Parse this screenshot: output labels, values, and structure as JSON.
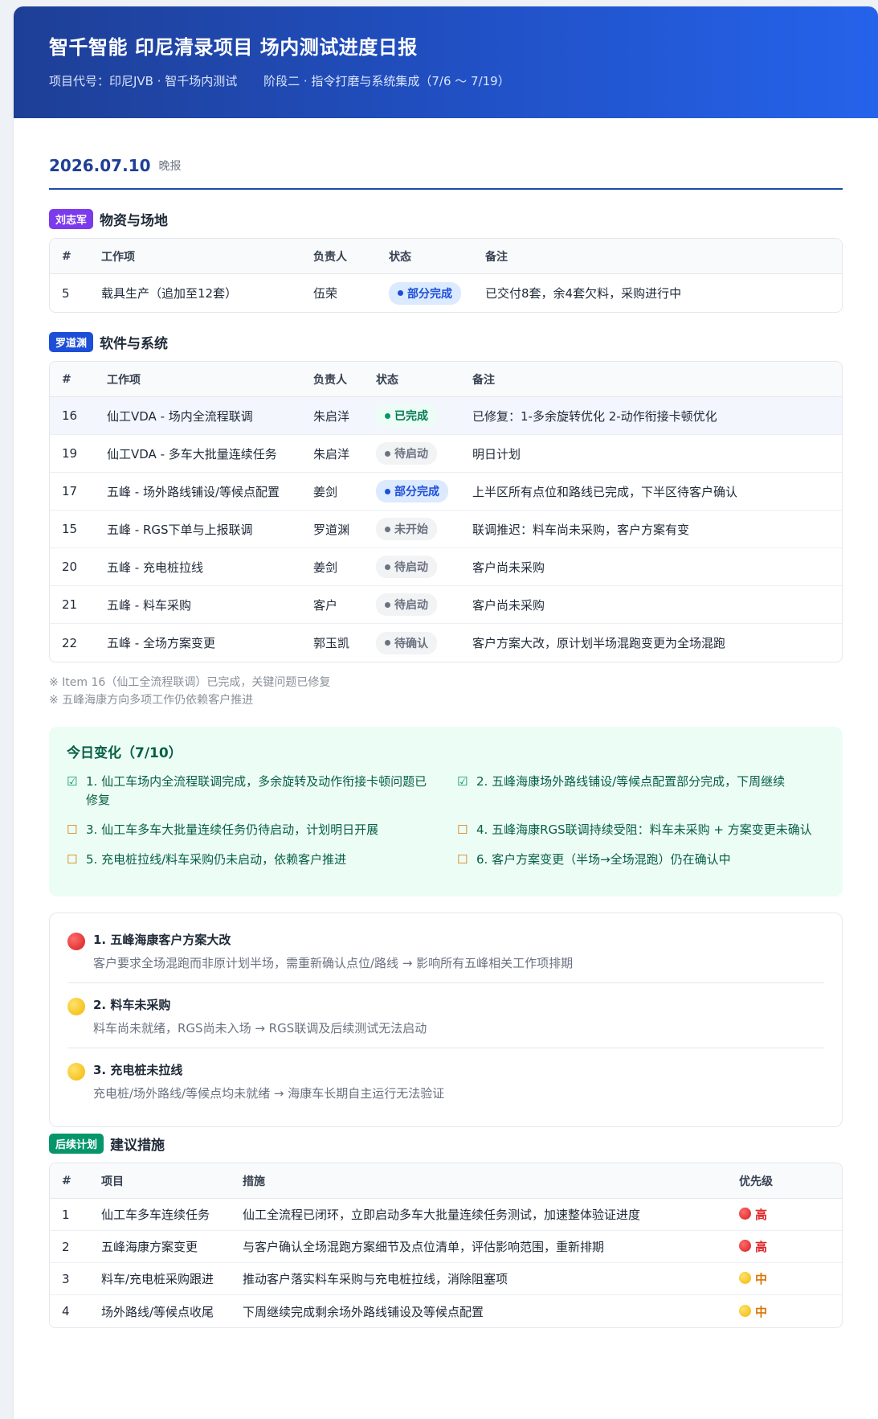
{
  "header": {
    "title": "智千智能 印尼清录项目 场内测试进度日报",
    "project_code": "项目代号：印尼JVB · 智千场内测试",
    "phase": "阶段二 · 指令打磨与系统集成（7/6 ～ 7/19）"
  },
  "report": {
    "date": "2026.07.10",
    "tag": "晚报"
  },
  "section_materials": {
    "owner": "刘志军",
    "owner_color": "#7c3aed",
    "title": "物资与场地",
    "columns": [
      "#",
      "工作项",
      "负责人",
      "状态",
      "备注"
    ],
    "rows": [
      {
        "no": "5",
        "item": "载具生产（追加至12套）",
        "owner": "伍荣",
        "status": "部分完成",
        "note": "已交付8套，余4套欠料，采购进行中"
      }
    ]
  },
  "section_software": {
    "owner": "罗道渊",
    "owner_color": "#1d4ed8",
    "title": "软件与系统",
    "columns": [
      "#",
      "工作项",
      "负责人",
      "状态",
      "备注"
    ],
    "rows": [
      {
        "no": "16",
        "item": "仙工VDA - 场内全流程联调",
        "owner": "朱启洋",
        "status": "已完成",
        "note": "已修复：1-多余旋转优化 2-动作衔接卡顿优化"
      },
      {
        "no": "19",
        "item": "仙工VDA - 多车大批量连续任务",
        "owner": "朱启洋",
        "status": "待启动",
        "note": "明日计划"
      },
      {
        "no": "17",
        "item": "五峰 - 场外路线铺设/等候点配置",
        "owner": "姜剑",
        "status": "部分完成",
        "note": "上半区所有点位和路线已完成，下半区待客户确认"
      },
      {
        "no": "15",
        "item": "五峰 - RGS下单与上报联调",
        "owner": "罗道渊",
        "status": "未开始",
        "note": "联调推迟：料车尚未采购，客户方案有变"
      },
      {
        "no": "20",
        "item": "五峰 - 充电桩拉线",
        "owner": "姜剑",
        "status": "待启动",
        "note": "客户尚未采购"
      },
      {
        "no": "21",
        "item": "五峰 - 料车采购",
        "owner": "客户",
        "status": "待启动",
        "note": "客户尚未采购"
      },
      {
        "no": "22",
        "item": "五峰 - 全场方案变更",
        "owner": "郭玉凯",
        "status": "待确认",
        "note": "客户方案大改，原计划半场混跑变更为全场混跑"
      }
    ]
  },
  "notes": [
    "※ Item 16（仙工全流程联调）已完成，关键问题已修复",
    "※ 五峰海康方向多项工作仍依赖客户推进"
  ],
  "changes": {
    "title": "今日变化（7/10）",
    "items": [
      {
        "mark": "☑",
        "kind": "ok",
        "text": "1. 仙工车场内全流程联调完成，多余旋转及动作衔接卡顿问题已修复"
      },
      {
        "mark": "☑",
        "kind": "ok",
        "text": "2. 五峰海康场外路线铺设/等候点配置部分完成，下周继续"
      },
      {
        "mark": "☐",
        "kind": "pend",
        "text": "3. 仙工车多车大批量连续任务仍待启动，计划明日开展"
      },
      {
        "mark": "☐",
        "kind": "pend",
        "text": "4. 五峰海康RGS联调持续受阻：料车未采购 + 方案变更未确认"
      },
      {
        "mark": "☐",
        "kind": "pend",
        "text": "5. 充电桩拉线/料车采购仍未启动，依赖客户推进"
      },
      {
        "mark": "☐",
        "kind": "pend",
        "text": "6. 客户方案变更（半场→全场混跑）仍在确认中"
      }
    ]
  },
  "risks": [
    {
      "level": "red",
      "title": "1. 五峰海康客户方案大改",
      "desc": "客户要求全场混跑而非原计划半场，需重新确认点位/路线 → 影响所有五峰相关工作项排期"
    },
    {
      "level": "yellow",
      "title": "2. 料车未采购",
      "desc": "料车尚未就绪，RGS尚未入场 → RGS联调及后续测试无法启动"
    },
    {
      "level": "yellow",
      "title": "3. 充电桩未拉线",
      "desc": "充电桩/场外路线/等候点均未就绪 → 海康车长期自主运行无法验证"
    }
  ],
  "plan": {
    "owner": "后续计划",
    "owner_color": "#059669",
    "title": "建议措施",
    "columns": [
      "#",
      "项目",
      "措施",
      "优先级"
    ],
    "rows": [
      {
        "no": "1",
        "item": "仙工车多车连续任务",
        "action": "仙工全流程已闭环，立即启动多车大批量连续任务测试，加速整体验证进度",
        "priority": "高",
        "level": "high"
      },
      {
        "no": "2",
        "item": "五峰海康方案变更",
        "action": "与客户确认全场混跑方案细节及点位清单，评估影响范围，重新排期",
        "priority": "高",
        "level": "high"
      },
      {
        "no": "3",
        "item": "料车/充电桩采购跟进",
        "action": "推动客户落实料车采购与充电桩拉线，消除阻塞项",
        "priority": "中",
        "level": "mid"
      },
      {
        "no": "4",
        "item": "场外路线/等候点收尾",
        "action": "下周继续完成剩余场外路线铺设及等候点配置",
        "priority": "中",
        "level": "mid"
      }
    ]
  }
}
